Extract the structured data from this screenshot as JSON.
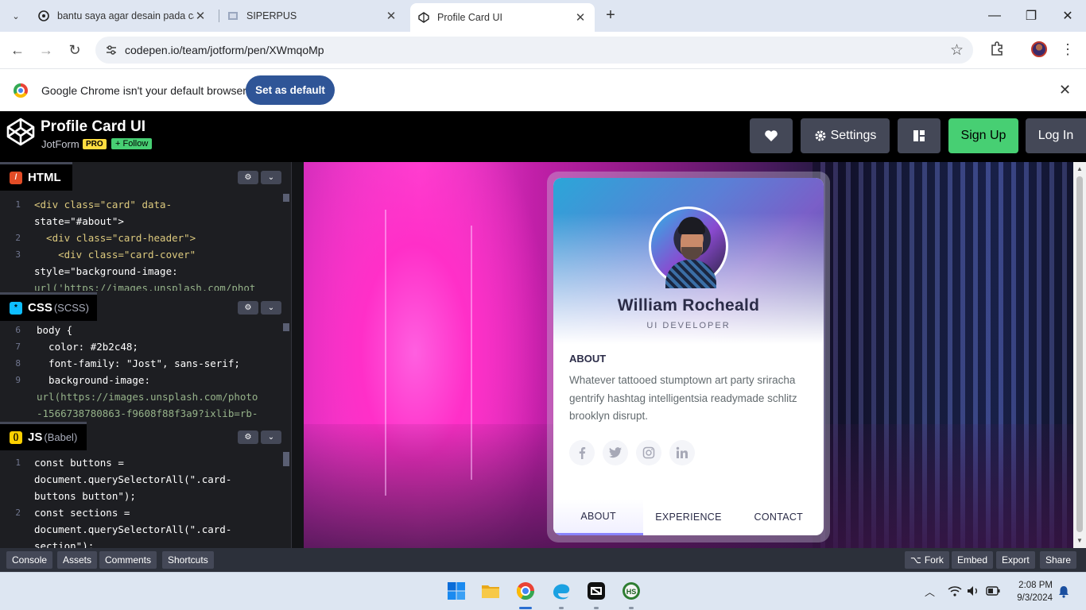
{
  "browser": {
    "tabs": [
      {
        "title": "bantu saya agar desain pada ca",
        "active": false
      },
      {
        "title": "SIPERPUS",
        "active": false
      },
      {
        "title": "Profile Card UI",
        "active": true
      }
    ],
    "url": "codepen.io/team/jotform/pen/XWmqoMp",
    "infobar": {
      "message": "Google Chrome isn't your default browser",
      "button": "Set as default"
    }
  },
  "codepen": {
    "pen_title": "Profile Card UI",
    "owner": "JotForm",
    "pro_badge": "PRO",
    "follow_label": "+ Follow",
    "header_buttons": {
      "settings": "Settings",
      "signup": "Sign Up",
      "login": "Log In"
    },
    "editors": {
      "html": {
        "label": "HTML",
        "sub": ""
      },
      "css": {
        "label": "CSS",
        "sub": "(SCSS)"
      },
      "js": {
        "label": "JS",
        "sub": "(Babel)"
      }
    },
    "html_code": [
      {
        "ln": "1",
        "text": "<div class=\"card\" data-"
      },
      {
        "ln": "",
        "text": "state=\"#about\">"
      },
      {
        "ln": "2",
        "text": "  <div class=\"card-header\">"
      },
      {
        "ln": "3",
        "text": "    <div class=\"card-cover\""
      },
      {
        "ln": "",
        "text": "style=\"background-image:"
      },
      {
        "ln": "",
        "text": "url('https://images.unsplash.com/phot"
      }
    ],
    "css_code": [
      {
        "ln": "6",
        "text": "body {"
      },
      {
        "ln": "7",
        "text": "  color: #2b2c48;"
      },
      {
        "ln": "8",
        "text": "  font-family: \"Jost\", sans-serif;"
      },
      {
        "ln": "9",
        "text": "  background-image:"
      },
      {
        "ln": "",
        "text": "url(https://images.unsplash.com/photo"
      },
      {
        "ln": "",
        "text": "-1566738780863-f9608f88f3a9?ixlib=rb-"
      }
    ],
    "js_code": [
      {
        "ln": "1",
        "text": "const buttons ="
      },
      {
        "ln": "",
        "text": "document.querySelectorAll(\".card-"
      },
      {
        "ln": "",
        "text": "buttons button\");"
      },
      {
        "ln": "2",
        "text": "const sections ="
      },
      {
        "ln": "",
        "text": "document.querySelectorAll(\".card-"
      },
      {
        "ln": "",
        "text": "section\");"
      }
    ],
    "footer": {
      "left": [
        "Console",
        "Assets",
        "Comments",
        "Shortcuts"
      ],
      "right": [
        "Fork",
        "Embed",
        "Export",
        "Share"
      ]
    }
  },
  "card": {
    "name": "William Rocheald",
    "role": "UI DEVELOPER",
    "about_title": "ABOUT",
    "about_text": "Whatever tattooed stumptown art party sriracha gentrify hashtag intelligentsia readymade schlitz brooklyn disrupt.",
    "social": [
      "facebook-icon",
      "twitter-icon",
      "instagram-icon",
      "linkedin-icon"
    ],
    "tabs": [
      "ABOUT",
      "EXPERIENCE",
      "CONTACT"
    ],
    "active_tab": "ABOUT",
    "accent": "#8a84ff",
    "text_color": "#2b2c48"
  },
  "taskbar": {
    "time": "2:08 PM",
    "date": "9/3/2024"
  }
}
